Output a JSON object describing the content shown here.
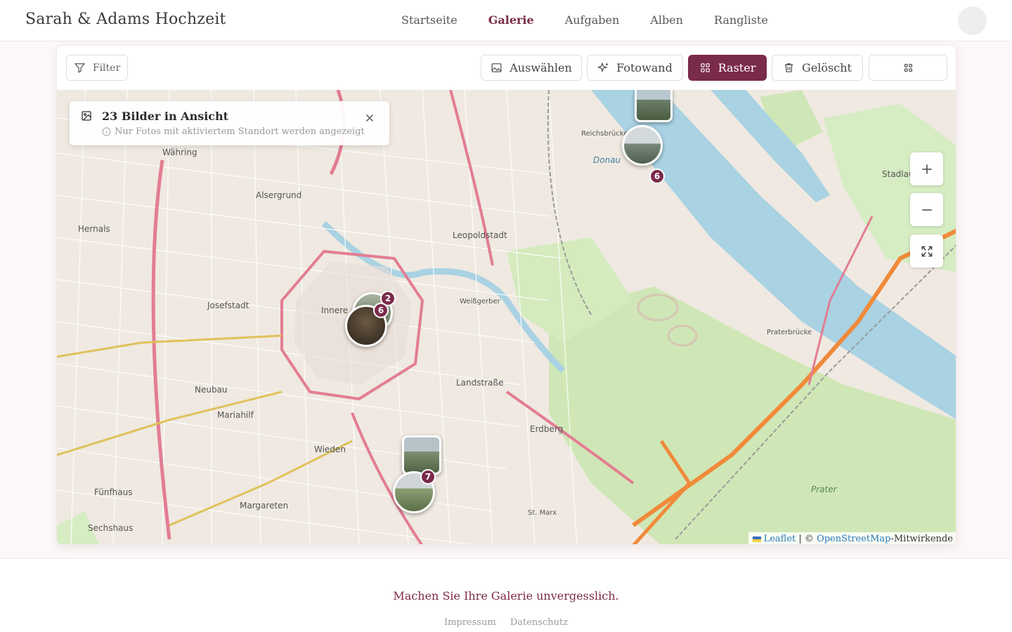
{
  "header": {
    "brand": "Sarah & Adams Hochzeit",
    "nav": [
      "Startseite",
      "Galerie",
      "Aufgaben",
      "Alben",
      "Rangliste"
    ],
    "active": "Galerie"
  },
  "toolbar": {
    "filter": "Filter",
    "select": "Auswählen",
    "wall": "Fotowand",
    "grid": "Raster",
    "deleted": "Gelöscht"
  },
  "info": {
    "title": "23 Bilder in Ansicht",
    "subtitle": "Nur Fotos mit aktiviertem Standort werden angezeigt"
  },
  "clusters": [
    {
      "count": "6"
    },
    {
      "count": "2"
    },
    {
      "count": "6"
    },
    {
      "count": "7"
    }
  ],
  "map_labels": {
    "innere": "Innere",
    "leopoldstadt": "Leopoldstadt",
    "landstrasse": "Landstraße",
    "erdberg": "Erdberg",
    "josefstadt": "Josefstadt",
    "alsergrund": "Alsergrund",
    "neubau": "Neubau",
    "mariahilf": "Mariahilf",
    "wieden": "Wieden",
    "margareten": "Margareten",
    "praterbruecke": "Praterbrücke",
    "prater": "Prater",
    "stadlau": "Stadlau",
    "donau": "Donau",
    "wahring": "Währing",
    "hernals": "Hernals",
    "sechshaus": "Sechshaus",
    "fuenfhaus": "Fünfhaus",
    "stmarx": "St. Marx",
    "weissgerber": "Weißgerber",
    "reichsbruecke": "Reichsbrücke"
  },
  "attribution": {
    "leaflet": "Leaflet",
    "sep": " | © ",
    "osm": "OpenStreetMap",
    "suffix": "-Mitwirkende"
  },
  "footer": {
    "tagline": "Machen Sie Ihre Galerie unvergesslich.",
    "impressum": "Impressum",
    "datenschutz": "Datenschutz"
  },
  "colors": {
    "accent": "#7a2a4a",
    "river": "#a9d2e3",
    "park": "#cfe7b6"
  }
}
